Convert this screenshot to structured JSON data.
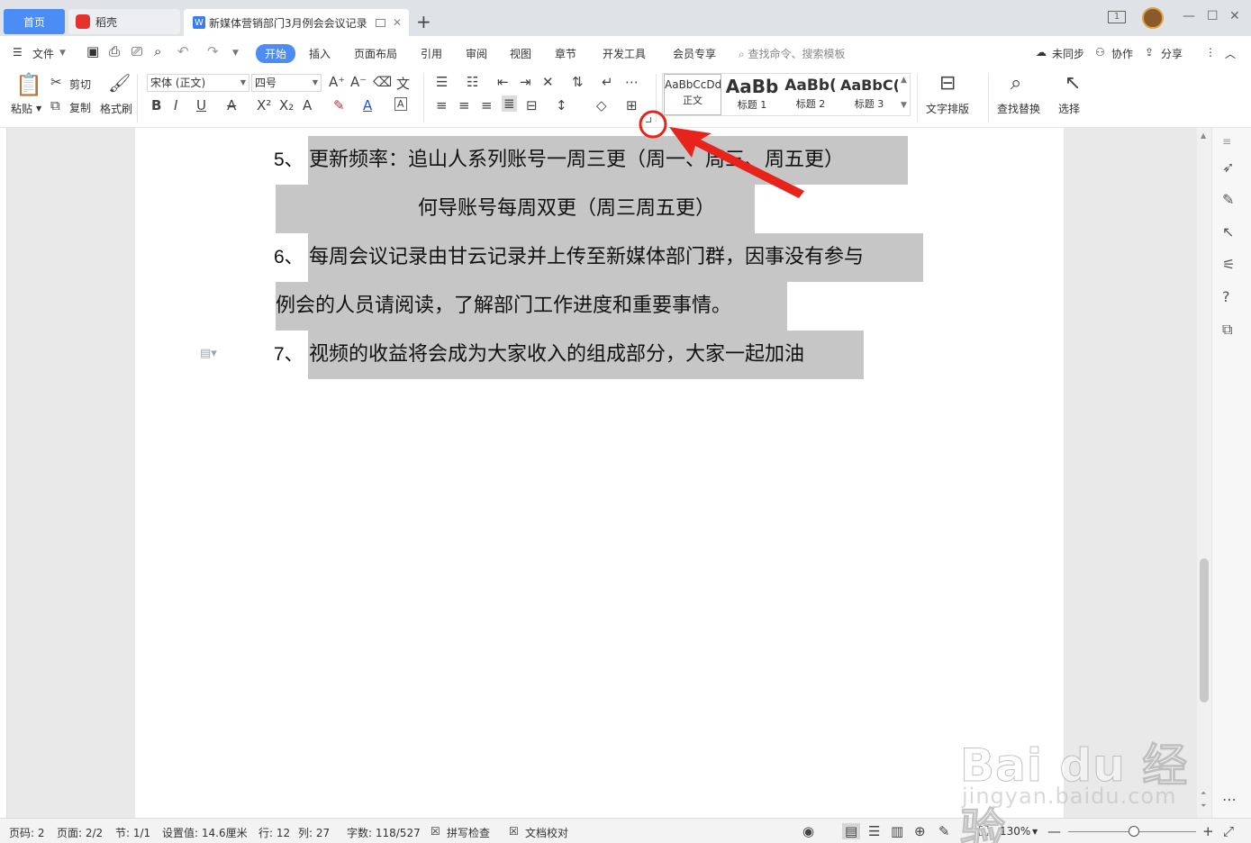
{
  "titlebar": {
    "tab_home": "首页",
    "tab_daoke": "稻壳",
    "tab_doc": "新媒体营销部门3月例会会议记录",
    "doc_badge": "W",
    "new_tab": "+",
    "window_controls": [
      "—",
      "☐",
      "✕"
    ],
    "badge_count": "1"
  },
  "menubar": {
    "file": "文件",
    "tabs": [
      "开始",
      "插入",
      "页面布局",
      "引用",
      "审阅",
      "视图",
      "章节",
      "开发工具",
      "会员专享"
    ],
    "search_placeholder": "查找命令、搜索模板",
    "sync": "未同步",
    "collab": "协作",
    "share": "分享"
  },
  "ribbon": {
    "paste": "粘贴",
    "cut": "剪切",
    "copy": "复制",
    "format_painter": "格式刷",
    "font_name": "宋体 (正文)",
    "font_size": "四号",
    "styles": [
      {
        "sample": "AaBbCcDd",
        "name": "正文"
      },
      {
        "sample": "AaBb",
        "name": "标题 1"
      },
      {
        "sample": "AaBb(",
        "name": "标题 2"
      },
      {
        "sample": "AaBbC(",
        "name": "标题 3"
      }
    ],
    "text_layout": "文字排版",
    "find_replace": "查找替换",
    "select": "选择"
  },
  "document": {
    "lines": [
      {
        "num": "5、",
        "text": "更新频率：追山人系列账号一周三更（周一、周三、周五更）"
      },
      {
        "num": "",
        "text": "何导账号每周双更（周三周五更）"
      },
      {
        "num": "6、",
        "text": "每周会议记录由甘云记录并上传至新媒体部门群，因事没有参与"
      },
      {
        "num": "",
        "text": "例会的人员请阅读，了解部门工作进度和重要事情。"
      },
      {
        "num": "7、",
        "text": "视频的收益将会成为大家收入的组成部分，大家一起加油"
      }
    ]
  },
  "statusbar": {
    "page_code": "页码: 2",
    "pages": "页面: 2/2",
    "section": "节: 1/1",
    "setting": "设置值: 14.6厘米",
    "row": "行: 12",
    "col": "列: 27",
    "words": "字数: 118/527",
    "spell_check": "拼写检查",
    "doc_proof": "文档校对",
    "zoom": "130%"
  },
  "watermark": {
    "main": "Bai du 经验",
    "sub": "jingyan.baidu.com"
  },
  "colors": {
    "accent": "#4b8cf5",
    "highlight": "#c6c6c6",
    "annotation_red": "#e8231b"
  }
}
